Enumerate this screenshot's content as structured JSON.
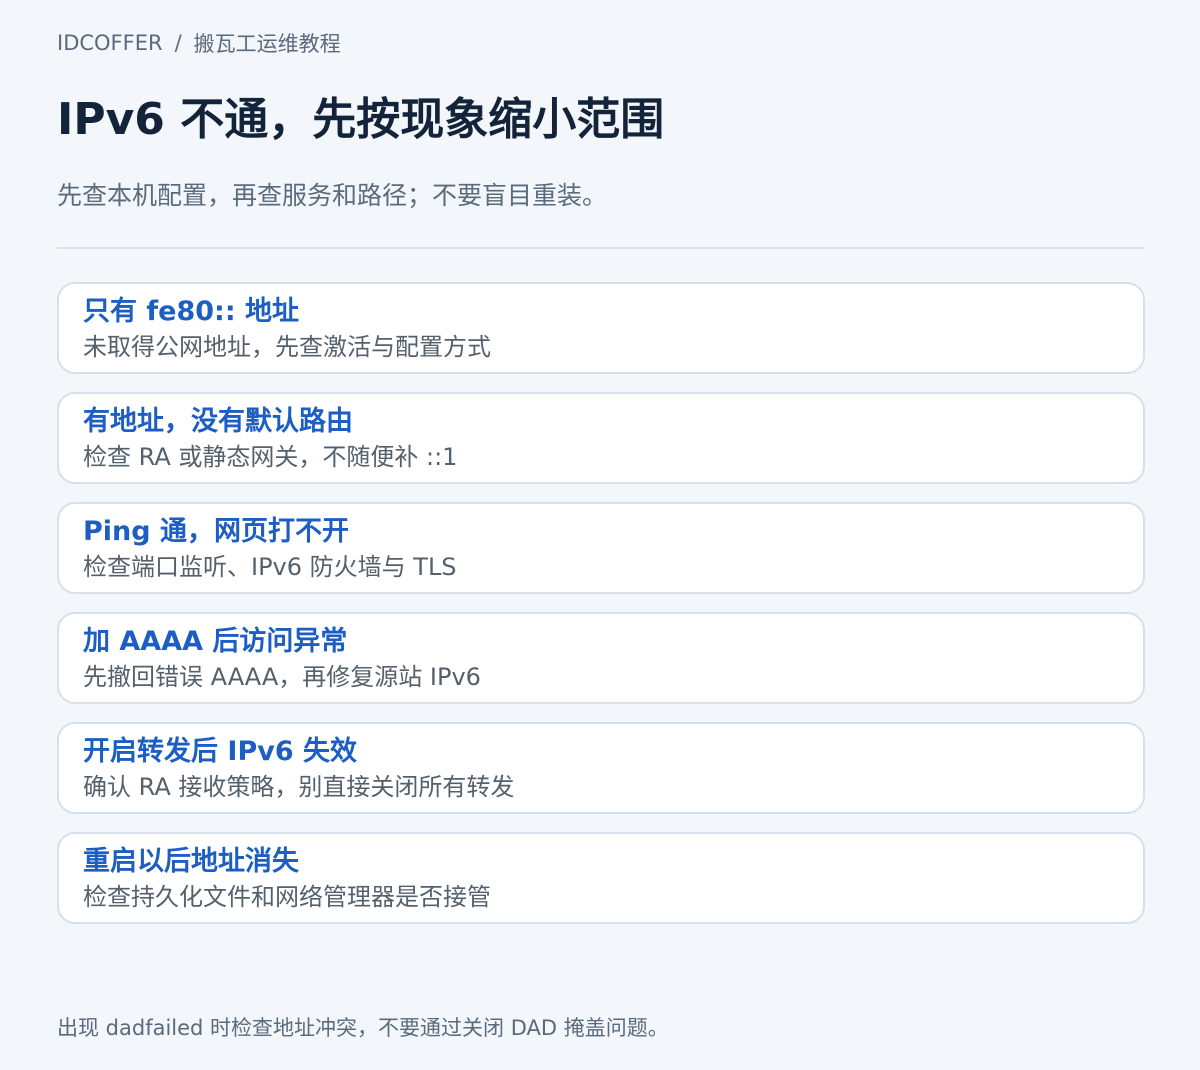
{
  "breadcrumb": {
    "site": "IDCOFFER",
    "separator": "/",
    "section": "搬瓦工运维教程"
  },
  "header": {
    "title": "IPv6 不通，先按现象缩小范围",
    "subtitle": "先查本机配置，再查服务和路径；不要盲目重装。"
  },
  "cards": [
    {
      "title": "只有 fe80:: 地址",
      "desc": "未取得公网地址，先查激活与配置方式"
    },
    {
      "title": "有地址，没有默认路由",
      "desc": "检查 RA 或静态网关，不随便补 ::1"
    },
    {
      "title": "Ping 通，网页打不开",
      "desc": "检查端口监听、IPv6 防火墙与 TLS"
    },
    {
      "title": "加 AAAA 后访问异常",
      "desc": "先撤回错误 AAAA，再修复源站 IPv6"
    },
    {
      "title": "开启转发后 IPv6 失效",
      "desc": "确认 RA 接收策略，别直接关闭所有转发"
    },
    {
      "title": "重启以后地址消失",
      "desc": "检查持久化文件和网络管理器是否接管"
    }
  ],
  "footer": {
    "note": "出现 dadfailed 时检查地址冲突，不要通过关闭 DAD 掩盖问题。"
  },
  "colors": {
    "background": "#f3f6fa",
    "title": "#12233a",
    "accent": "#1d5ec4",
    "muted": "#5a6b7d",
    "card_border": "#d6e0ea"
  }
}
